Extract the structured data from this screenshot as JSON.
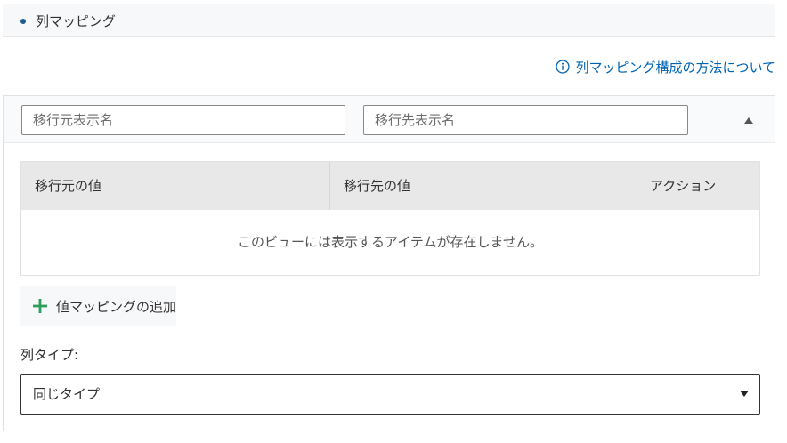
{
  "section": {
    "title": "列マッピング"
  },
  "help_link": {
    "label": "列マッピング構成の方法について",
    "color": "#0063b1"
  },
  "mapping": {
    "source_placeholder": "移行元表示名",
    "target_placeholder": "移行先表示名",
    "source_value": "",
    "target_value": ""
  },
  "table": {
    "columns": [
      "移行元の値",
      "移行先の値",
      "アクション"
    ],
    "rows": [],
    "empty_message": "このビューには表示するアイテムが存在しません。"
  },
  "add_value_mapping": {
    "label": "値マッピングの追加",
    "icon_color": "#2e9e5b"
  },
  "column_type": {
    "label": "列タイプ:",
    "selected": "同じタイプ"
  },
  "icons": {
    "help": "info-icon",
    "collapse": "triangle-up-icon",
    "add": "plus-icon",
    "dropdown": "triangle-down-icon"
  }
}
